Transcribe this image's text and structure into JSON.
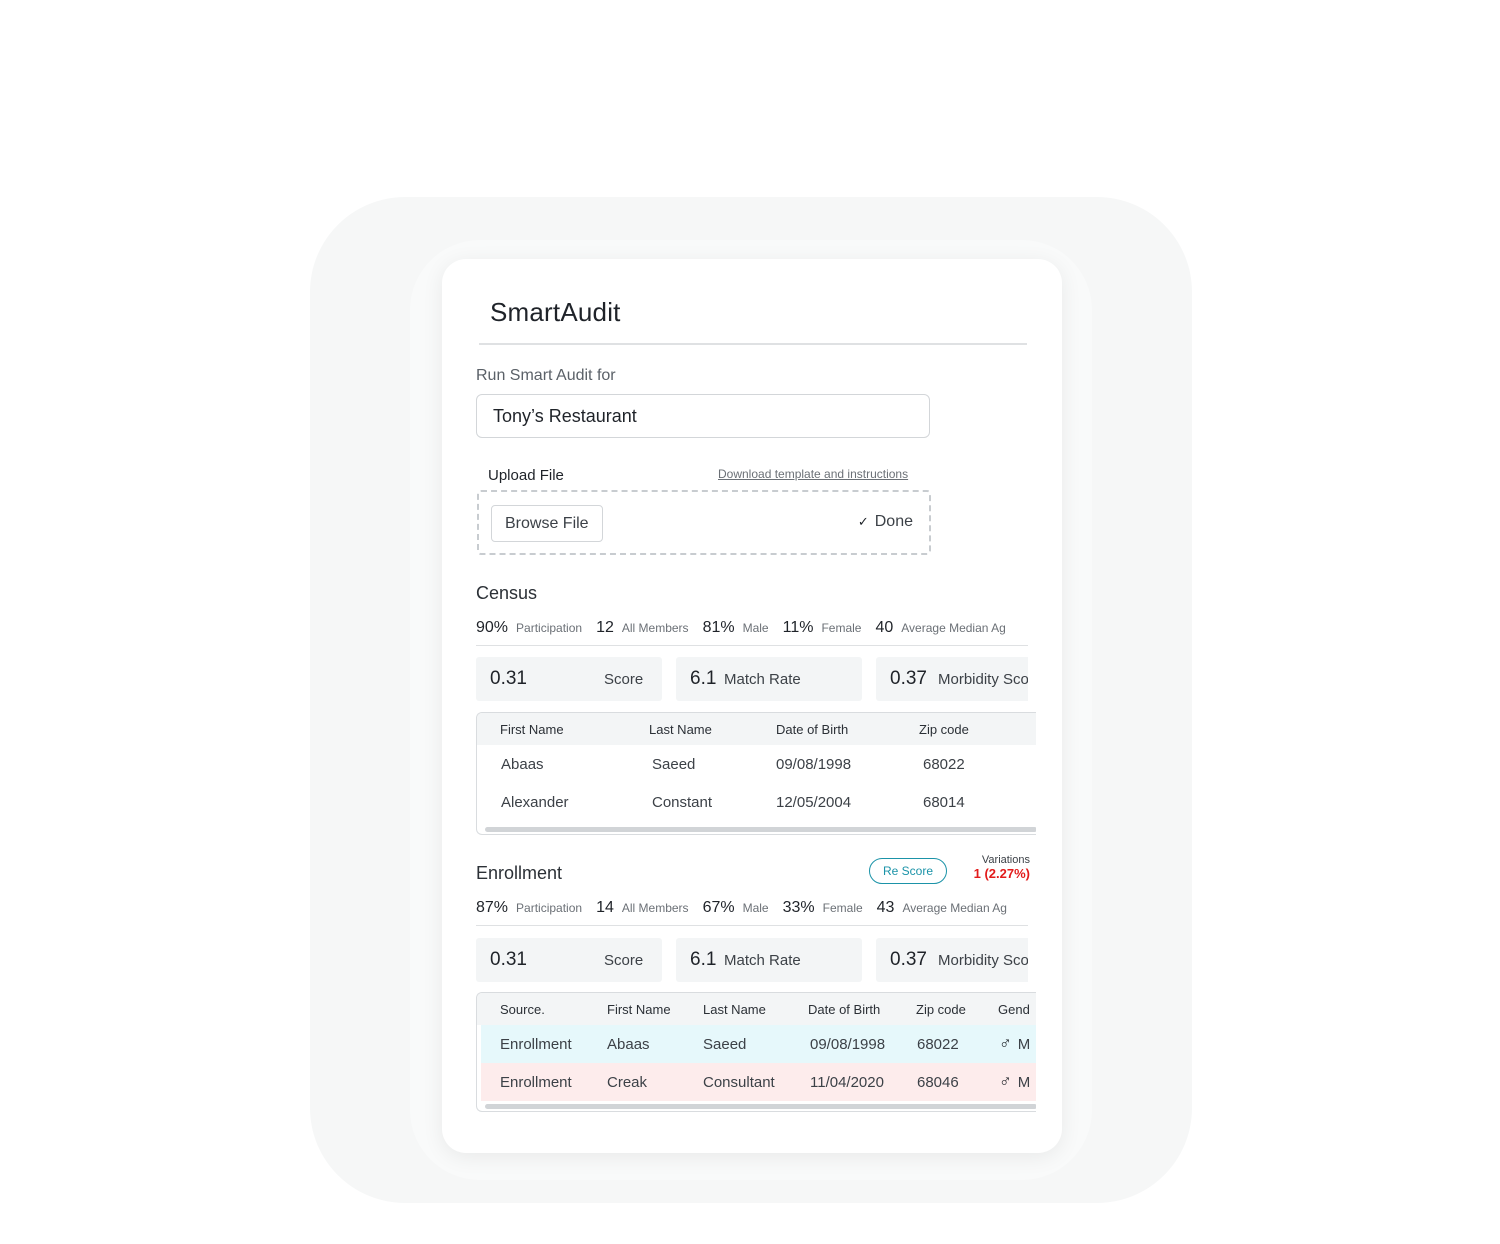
{
  "app": {
    "title": "SmartAudit"
  },
  "audit": {
    "run_label": "Run Smart Audit for",
    "company_value": "Tony’s Restaurant"
  },
  "upload": {
    "label": "Upload File",
    "download_link": "Download template and instructions",
    "browse_label": "Browse File",
    "status": "Done",
    "status_icon": "check-icon"
  },
  "census": {
    "title": "Census",
    "stats": [
      {
        "value": "90%",
        "label": "Participation"
      },
      {
        "value": "12",
        "label": "All Members"
      },
      {
        "value": "81%",
        "label": "Male"
      },
      {
        "value": "11%",
        "label": "Female"
      },
      {
        "value": "40",
        "label": "Average Median Ag"
      }
    ],
    "metrics": [
      {
        "value": "0.31",
        "label": "Score"
      },
      {
        "value": "6.1",
        "label": "Match Rate"
      },
      {
        "value": "0.37",
        "label": "Morbidity Sco"
      }
    ],
    "table": {
      "columns": [
        "First Name",
        "Last Name",
        "Date of Birth",
        "Zip code"
      ],
      "rows": [
        [
          "Abaas",
          "Saeed",
          "09/08/1998",
          "68022"
        ],
        [
          "Alexander",
          "Constant",
          "12/05/2004",
          "68014"
        ]
      ]
    }
  },
  "enrollment": {
    "title": "Enrollment",
    "rescore_label": "Re Score",
    "variations_label": "Variations",
    "variations_value": "1 (2.27%)",
    "stats": [
      {
        "value": "87%",
        "label": "Participation"
      },
      {
        "value": "14",
        "label": "All Members"
      },
      {
        "value": "67%",
        "label": "Male"
      },
      {
        "value": "33%",
        "label": "Female"
      },
      {
        "value": "43",
        "label": "Average Median Ag"
      }
    ],
    "metrics": [
      {
        "value": "0.31",
        "label": "Score"
      },
      {
        "value": "6.1",
        "label": "Match Rate"
      },
      {
        "value": "0.37",
        "label": "Morbidity Sco"
      }
    ],
    "table": {
      "columns": [
        "Source.",
        "First Name",
        "Last Name",
        "Date of Birth",
        "Zip code",
        "Gend"
      ],
      "rows": [
        {
          "cells": [
            "Enrollment",
            "Abaas",
            "Saeed",
            "09/08/1998",
            "68022",
            "M"
          ],
          "highlight": "#e6f8fb",
          "gender_icon": "male-icon"
        },
        {
          "cells": [
            "Enrollment",
            "Creak",
            "Consultant",
            "11/04/2020",
            "68046",
            "M"
          ],
          "highlight": "#fdecec",
          "gender_icon": "male-icon"
        }
      ]
    }
  },
  "colors": {
    "accent": "#1b93a8",
    "variation_red": "#e21b1b",
    "metric_bg": "#f3f5f6"
  }
}
